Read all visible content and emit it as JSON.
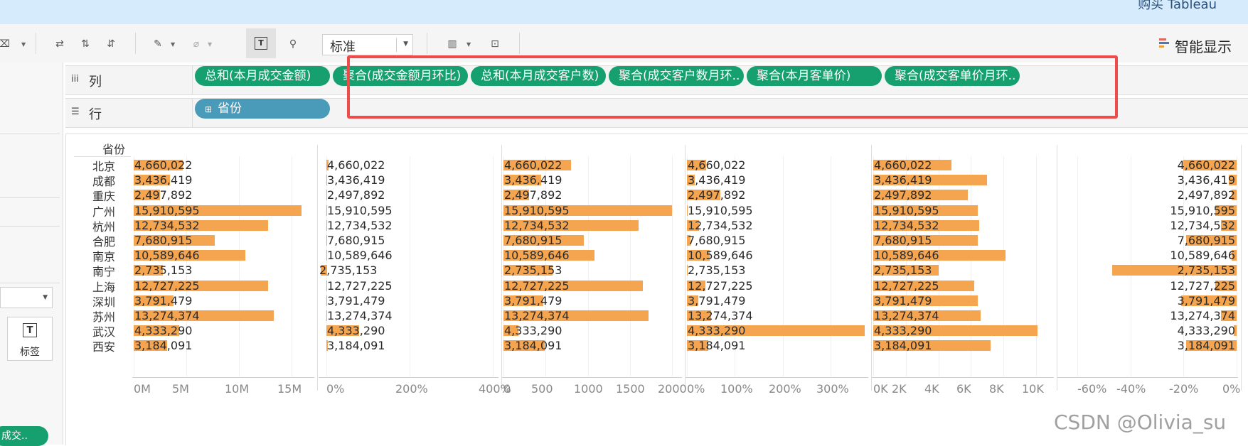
{
  "topbar": {
    "buy_link": "购买 Tableau"
  },
  "toolbar": {
    "fit_select": "标准",
    "show_me": "智能显示"
  },
  "left_panel": {
    "marks_label": "标签",
    "pill": "成交.."
  },
  "shelves": {
    "columns": {
      "label": "列",
      "icon": "columns-icon",
      "pills": [
        "总和(本月成交金额)",
        "聚合(成交金额月环比)",
        "总和(本月成交客户数)",
        "聚合(成交客户数月环..",
        "聚合(本月客单价)",
        "聚合(成交客单价月环.."
      ]
    },
    "rows": {
      "label": "行",
      "icon": "rows-icon",
      "pills": [
        "省份"
      ]
    }
  },
  "viz": {
    "row_header": "省份",
    "provinces": [
      "北京",
      "成都",
      "重庆",
      "广州",
      "杭州",
      "合肥",
      "南京",
      "南宁",
      "上海",
      "深圳",
      "苏州",
      "武汉",
      "西安"
    ],
    "labels": [
      "4,660,022",
      "3,436,419",
      "2,497,892",
      "15,910,595",
      "12,734,532",
      "7,680,915",
      "10,589,646",
      "2,735,153",
      "12,727,225",
      "3,791,479",
      "13,274,374",
      "4,333,290",
      "3,184,091"
    ],
    "panes": [
      {
        "name": "总和(本月成交金额)",
        "ticks": [
          "0M",
          "5M",
          "10M",
          "15M"
        ],
        "values": [
          4660022,
          3436419,
          2497892,
          15910595,
          12734532,
          7680915,
          10589646,
          2735153,
          12727225,
          3791479,
          13274374,
          4333290,
          3184091
        ]
      },
      {
        "name": "聚合(成交金额月环比)",
        "ticks": [
          "0%",
          "200%",
          "400%"
        ],
        "values": [
          0.05,
          0.01,
          0.0,
          0.0,
          0.0,
          0.0,
          0.0,
          -0.15,
          0.0,
          0.0,
          0.0,
          0.78,
          0.03
        ]
      },
      {
        "name": "总和(本月成交客户数)",
        "ticks": [
          "0",
          "500",
          "1000",
          "1500",
          "2000"
        ],
        "values": [
          800,
          450,
          300,
          2000,
          1600,
          950,
          1080,
          580,
          1650,
          470,
          1720,
          180,
          490
        ]
      },
      {
        "name": "聚合(成交客户数月环比)",
        "ticks": [
          "0%",
          "100%",
          "200%",
          "300%"
        ],
        "values": [
          0.4,
          0.16,
          0.7,
          0.0,
          0.25,
          0.08,
          0.48,
          0.02,
          0.38,
          0.24,
          0.5,
          3.7,
          0.45
        ]
      },
      {
        "name": "聚合(本月客单价)",
        "ticks": [
          "0K",
          "2K",
          "4K",
          "6K",
          "8K",
          "10K"
        ],
        "values": [
          4800,
          7000,
          5800,
          6400,
          6500,
          6400,
          8100,
          4000,
          6200,
          6400,
          6600,
          10100,
          7200
        ]
      },
      {
        "name": "聚合(成交客单价月环比)",
        "ticks": [
          "-60%",
          "-40%",
          "-20%",
          "0%"
        ],
        "values": [
          -0.2,
          -0.03,
          -0.02,
          -0.08,
          -0.06,
          -0.19,
          -0.02,
          -0.47,
          -0.08,
          -0.21,
          -0.06,
          -0.01,
          -0.19
        ]
      }
    ]
  },
  "colors": {
    "bar": "#f5a54f",
    "pill_green": "#16a06f",
    "pill_blue": "#4a9ab9",
    "highlight": "#ee4b4b"
  },
  "watermark": "CSDN @Olivia_su"
}
